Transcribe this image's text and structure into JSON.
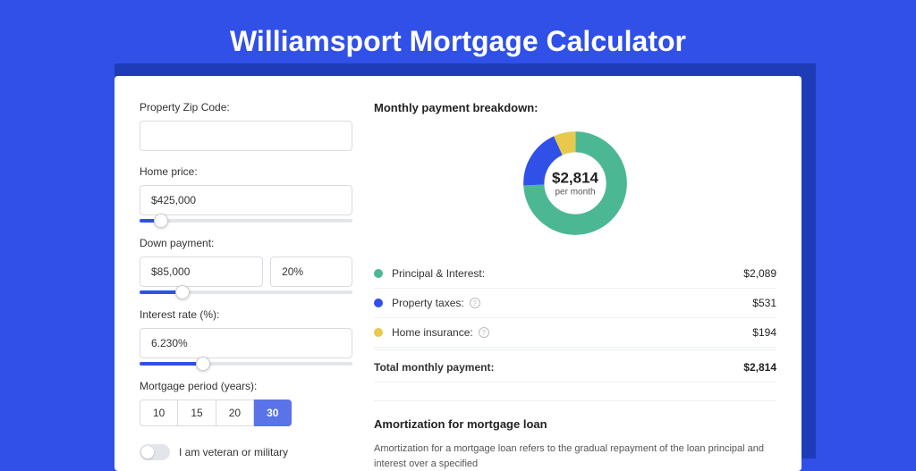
{
  "title": "Williamsport Mortgage Calculator",
  "form": {
    "zip": {
      "label": "Property Zip Code:",
      "value": ""
    },
    "home_price": {
      "label": "Home price:",
      "value": "$425,000",
      "slider_pct": 10
    },
    "down_payment": {
      "label": "Down payment:",
      "value": "$85,000",
      "pct_value": "20%",
      "slider_pct": 20
    },
    "interest": {
      "label": "Interest rate (%):",
      "value": "6.230%",
      "slider_pct": 30
    },
    "period": {
      "label": "Mortgage period (years):",
      "options": [
        "10",
        "15",
        "20",
        "30"
      ],
      "active": "30"
    },
    "veteran": {
      "label": "I am veteran or military",
      "on": false
    }
  },
  "breakdown": {
    "title": "Monthly payment breakdown:",
    "center_value": "$2,814",
    "center_sub": "per month",
    "rows": [
      {
        "label": "Principal & Interest:",
        "value": "$2,089",
        "color": "green",
        "help": false
      },
      {
        "label": "Property taxes:",
        "value": "$531",
        "color": "blue",
        "help": true
      },
      {
        "label": "Home insurance:",
        "value": "$194",
        "color": "yellow",
        "help": true
      }
    ],
    "total": {
      "label": "Total monthly payment:",
      "value": "$2,814"
    }
  },
  "amortization": {
    "title": "Amortization for mortgage loan",
    "text": "Amortization for a mortgage loan refers to the gradual repayment of the loan principal and interest over a specified"
  },
  "chart_data": {
    "type": "pie",
    "title": "Monthly payment breakdown",
    "series": [
      {
        "name": "Principal & Interest",
        "value": 2089,
        "color": "#4cb893"
      },
      {
        "name": "Property taxes",
        "value": 531,
        "color": "#3050e8"
      },
      {
        "name": "Home insurance",
        "value": 194,
        "color": "#e8c94c"
      }
    ],
    "total": 2814
  }
}
